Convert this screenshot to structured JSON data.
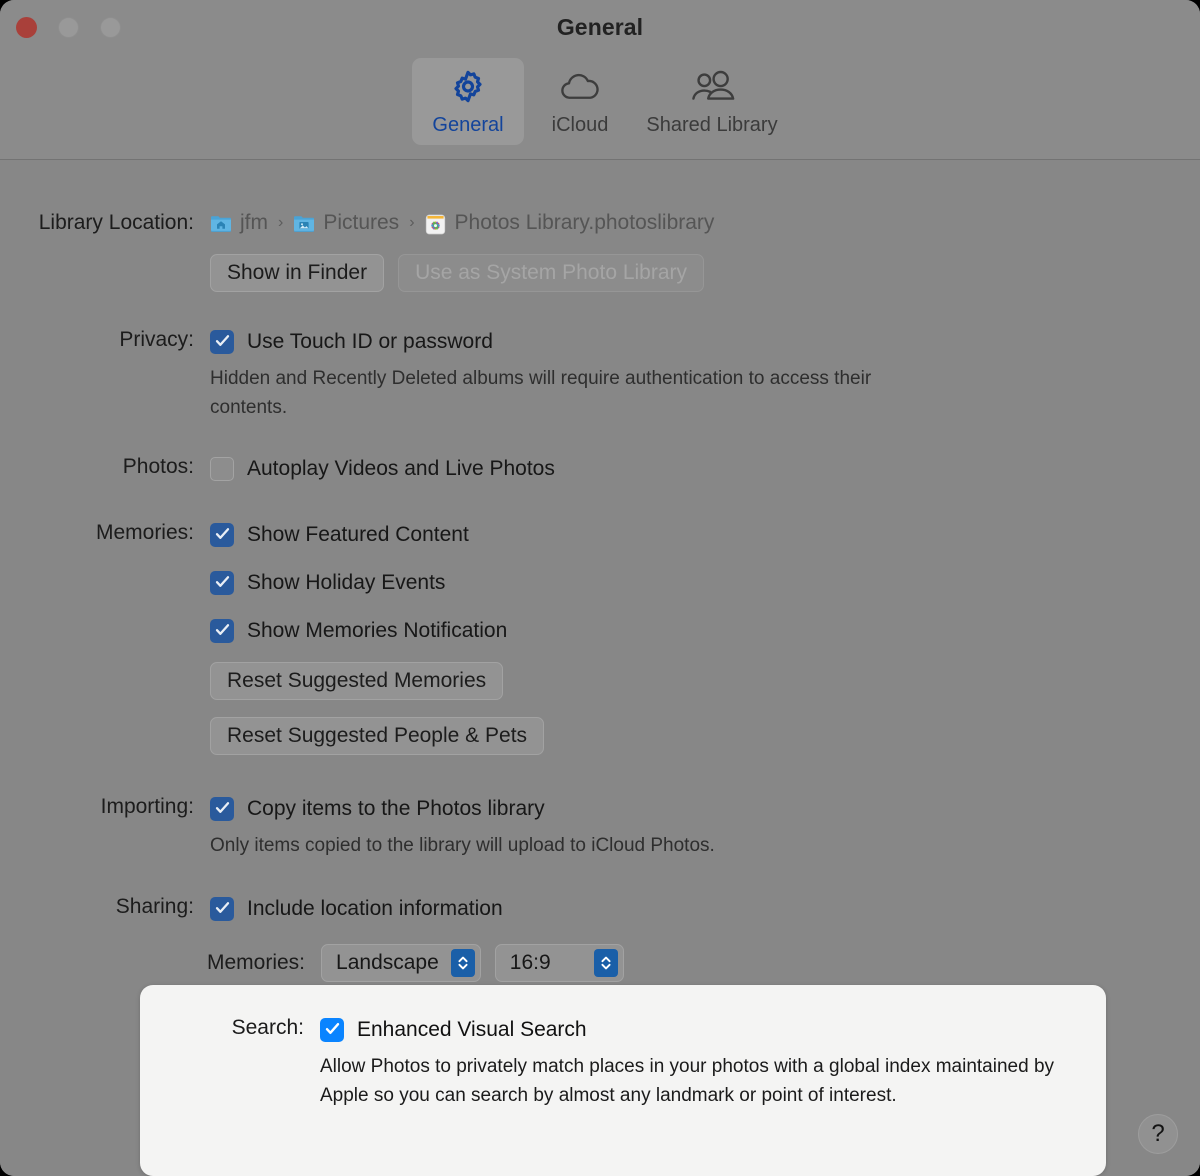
{
  "window": {
    "title": "General",
    "traffic_lights": [
      "close",
      "minimize",
      "zoom"
    ]
  },
  "toolbar": {
    "tabs": [
      {
        "label": "General",
        "icon": "gear-icon",
        "selected": true
      },
      {
        "label": "iCloud",
        "icon": "cloud-icon",
        "selected": false
      },
      {
        "label": "Shared Library",
        "icon": "people-icon",
        "selected": false
      }
    ]
  },
  "library_location": {
    "label": "Library Location:",
    "breadcrumb": [
      {
        "text": "jfm",
        "icon": "home-folder-icon"
      },
      {
        "text": "Pictures",
        "icon": "pictures-folder-icon"
      },
      {
        "text": "Photos Library.photoslibrary",
        "icon": "photos-app-icon"
      }
    ],
    "separator": "›",
    "buttons": [
      {
        "label": "Show in Finder",
        "enabled": true
      },
      {
        "label": "Use as System Photo Library",
        "enabled": false
      }
    ]
  },
  "privacy": {
    "label": "Privacy:",
    "checkbox": {
      "label": "Use Touch ID or password",
      "checked": true
    },
    "description": "Hidden and Recently Deleted albums will require authentication to access their contents."
  },
  "photos": {
    "label": "Photos:",
    "checkbox": {
      "label": "Autoplay Videos and Live Photos",
      "checked": false
    }
  },
  "memories": {
    "label": "Memories:",
    "checkboxes": [
      {
        "label": "Show Featured Content",
        "checked": true
      },
      {
        "label": "Show Holiday Events",
        "checked": true
      },
      {
        "label": "Show Memories Notification",
        "checked": true
      }
    ],
    "buttons": [
      {
        "label": "Reset Suggested Memories"
      },
      {
        "label": "Reset Suggested People & Pets"
      }
    ]
  },
  "importing": {
    "label": "Importing:",
    "checkbox": {
      "label": "Copy items to the Photos library",
      "checked": true
    },
    "description": "Only items copied to the library will upload to iCloud Photos."
  },
  "sharing": {
    "label": "Sharing:",
    "checkbox": {
      "label": "Include location information",
      "checked": true
    },
    "memories_label": "Memories:",
    "orientation_value": "Landscape",
    "aspect_value": "16:9"
  },
  "search": {
    "label": "Search:",
    "checkbox": {
      "label": "Enhanced Visual Search",
      "checked": true
    },
    "description": "Allow Photos to privately match places in your photos with a global index maintained by Apple so you can search by almost any landmark or point of interest."
  },
  "help_button": {
    "label": "?"
  },
  "colors": {
    "window_background": "#878787",
    "titlebar_background": "#8b8b8b",
    "accent_blue": "#0a84ff",
    "muted_accent_blue": "#2a5a9c",
    "tab_selected_text": "#13449b",
    "card_background": "#f4f4f3",
    "close_button": "#a9403a"
  }
}
